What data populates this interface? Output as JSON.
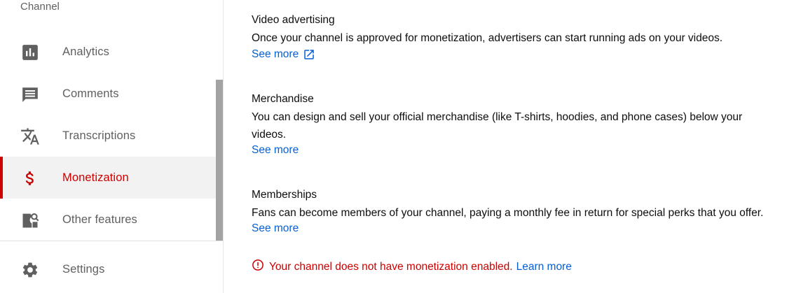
{
  "sidebar": {
    "section_header": "Channel",
    "items": [
      {
        "label": "Analytics",
        "icon": "analytics-icon"
      },
      {
        "label": "Comments",
        "icon": "comment-icon"
      },
      {
        "label": "Transcriptions",
        "icon": "translate-icon"
      },
      {
        "label": "Monetization",
        "icon": "dollar-icon",
        "active": true
      },
      {
        "label": "Other features",
        "icon": "other-features-icon"
      }
    ],
    "settings": {
      "label": "Settings",
      "icon": "gear-icon"
    }
  },
  "main": {
    "video_advertising": {
      "title": "Video advertising",
      "description": "Once your channel is approved for monetization, advertisers can start running ads on your videos.",
      "see_more": "See more"
    },
    "merchandise": {
      "title": "Merchandise",
      "description": "You can design and sell your official merchandise (like T-shirts, hoodies, and phone cases) below your videos.",
      "see_more": "See more"
    },
    "memberships": {
      "title": "Memberships",
      "description": "Fans can become members of your channel, paying a monthly fee in return for special perks that you offer.",
      "see_more": "See more"
    },
    "warning": {
      "text": "Your channel does not have monetization enabled.",
      "link": "Learn more"
    }
  },
  "colors": {
    "accent_red": "#cc0000",
    "link_blue": "#065fd4",
    "icon_gray": "#606060",
    "active_bg": "#f2f2f2"
  }
}
